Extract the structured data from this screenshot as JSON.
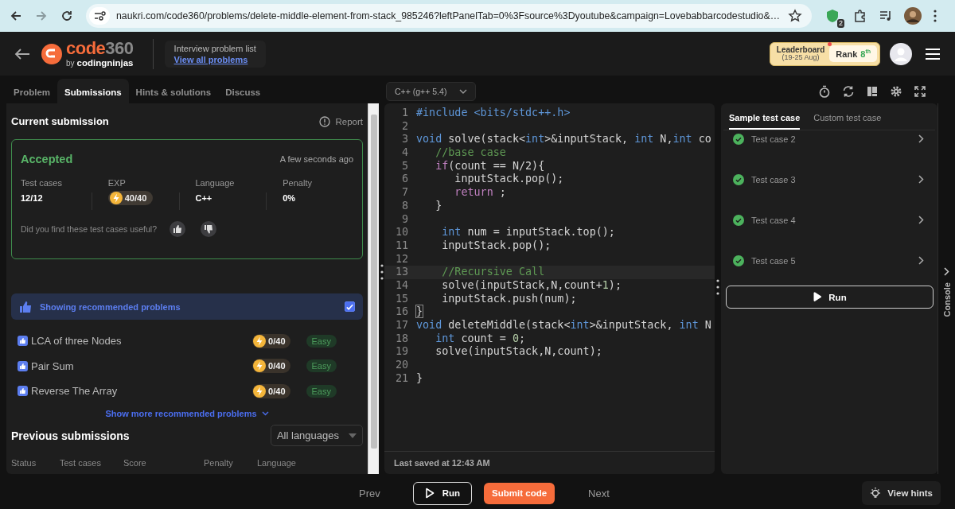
{
  "browser": {
    "url": "naukri.com/code360/problems/delete-middle-element-from-stack_985246?leftPanelTab=0%3Fsource%3Dyoutube&campaign=Lovebabbarcodestudio&…",
    "extension_badge": "2"
  },
  "header": {
    "logo_word": "code",
    "logo_number": "360",
    "logo_by": "by",
    "logo_brand": "codingninjas",
    "nav_caption": "Interview problem list",
    "nav_link": "View all problems",
    "leaderboard": {
      "title": "Leaderboard",
      "dates": "(19-25 Aug)",
      "rank_label": "Rank",
      "rank_value": "8$^{th}$",
      "notification": true
    }
  },
  "left_tabs": [
    {
      "label": "Problem",
      "selected": false
    },
    {
      "label": "Submissions",
      "selected": true
    },
    {
      "label": "Hints & solutions",
      "selected": false
    },
    {
      "label": "Discuss",
      "selected": false
    }
  ],
  "current_submission": {
    "title": "Current submission",
    "report": "Report",
    "status": "Accepted",
    "time": "A few seconds ago",
    "stats": [
      {
        "kind": "text",
        "label": "Test cases",
        "value": "12/12"
      },
      {
        "kind": "exp",
        "label": "EXP",
        "value": "40/40"
      },
      {
        "kind": "text",
        "label": "Language",
        "value": "C++"
      },
      {
        "kind": "text",
        "label": "Penalty",
        "value": "0%"
      }
    ],
    "feedback_question": "Did you find these test cases useful?"
  },
  "recommended": {
    "title": "Showing recommended problems",
    "checked": true,
    "problems": [
      {
        "title": "LCA of three Nodes",
        "exp": "0/40",
        "difficulty": "Easy"
      },
      {
        "title": "Pair Sum",
        "exp": "0/40",
        "difficulty": "Easy"
      },
      {
        "title": "Reverse The Array",
        "exp": "0/40",
        "difficulty": "Easy"
      }
    ],
    "show_more": "Show more recommended problems"
  },
  "previous_submissions": {
    "title": "Previous submissions",
    "filter": "All languages",
    "columns": [
      "Status",
      "Test cases",
      "Score",
      "Penalty",
      "Language"
    ]
  },
  "editor": {
    "language": "C++ (g++ 5.4)",
    "last_saved": "Last saved at 12:43 AM",
    "lines": [
      {
        "number": "1",
        "current": false,
        "tokens": [
          {
            "kind": "preproc",
            "text": "#include <bits/stdc++.h>"
          }
        ]
      },
      {
        "number": "2",
        "current": false
      },
      {
        "number": "3",
        "current": false,
        "tokens": [
          {
            "kind": "keyword",
            "text": "void"
          },
          {
            "kind": "plain",
            "text": " solve(stack<"
          },
          {
            "kind": "keyword",
            "text": "int"
          },
          {
            "kind": "plain",
            "text": ">&inputStack, "
          },
          {
            "kind": "keyword",
            "text": "int"
          },
          {
            "kind": "plain",
            "text": " N,"
          },
          {
            "kind": "keyword",
            "text": "int"
          },
          {
            "kind": "plain",
            "text": " co"
          }
        ]
      },
      {
        "number": "4",
        "current": false,
        "tokens": [
          {
            "kind": "comment",
            "text": "   //base case"
          }
        ]
      },
      {
        "number": "5",
        "current": false,
        "tokens": [
          {
            "kind": "control",
            "text": "   if"
          },
          {
            "kind": "plain",
            "text": "(count == N/2){"
          }
        ]
      },
      {
        "number": "6",
        "current": false,
        "tokens": [
          {
            "kind": "plain",
            "text": "      inputStack.pop();"
          }
        ]
      },
      {
        "number": "7",
        "current": false,
        "tokens": [
          {
            "kind": "control",
            "text": "      return"
          },
          {
            "kind": "plain",
            "text": " ;"
          }
        ]
      },
      {
        "number": "8",
        "current": false,
        "tokens": [
          {
            "kind": "plain",
            "text": "   }"
          }
        ]
      },
      {
        "number": "9",
        "current": false
      },
      {
        "number": "10",
        "current": false,
        "tokens": [
          {
            "kind": "keyword",
            "text": "    int"
          },
          {
            "kind": "plain",
            "text": " num = inputStack.top();"
          }
        ]
      },
      {
        "number": "11",
        "current": false,
        "tokens": [
          {
            "kind": "plain",
            "text": "    inputStack.pop();"
          }
        ]
      },
      {
        "number": "12",
        "current": false
      },
      {
        "number": "13",
        "current": true,
        "tokens": [
          {
            "kind": "comment",
            "text": "    //Recursive Call"
          }
        ]
      },
      {
        "number": "14",
        "current": false,
        "tokens": [
          {
            "kind": "plain",
            "text": "    solve(inputStack,N,count+"
          },
          {
            "kind": "number",
            "text": "1"
          },
          {
            "kind": "plain",
            "text": ");"
          }
        ]
      },
      {
        "number": "15",
        "current": false,
        "tokens": [
          {
            "kind": "plain",
            "text": "    inputStack.push(num);"
          }
        ]
      },
      {
        "number": "16",
        "current": false,
        "tokens": [
          {
            "kind": "matched",
            "text": "}"
          }
        ]
      },
      {
        "number": "17",
        "current": false,
        "tokens": [
          {
            "kind": "keyword",
            "text": "void"
          },
          {
            "kind": "plain",
            "text": " deleteMiddle(stack<"
          },
          {
            "kind": "keyword",
            "text": "int"
          },
          {
            "kind": "plain",
            "text": ">&inputStack, "
          },
          {
            "kind": "keyword",
            "text": "int"
          },
          {
            "kind": "plain",
            "text": " N"
          }
        ]
      },
      {
        "number": "18",
        "current": false,
        "tokens": [
          {
            "kind": "keyword",
            "text": "   int"
          },
          {
            "kind": "plain",
            "text": " count = "
          },
          {
            "kind": "number",
            "text": "0"
          },
          {
            "kind": "plain",
            "text": ";"
          }
        ]
      },
      {
        "number": "19",
        "current": false,
        "tokens": [
          {
            "kind": "plain",
            "text": "   solve(inputStack,N,count);"
          }
        ]
      },
      {
        "number": "20",
        "current": false
      },
      {
        "number": "21",
        "current": false,
        "tokens": [
          {
            "kind": "plain",
            "text": "}"
          }
        ]
      }
    ]
  },
  "test_panel": {
    "tabs": [
      {
        "label": "Sample test case",
        "selected": true
      },
      {
        "label": "Custom test case",
        "selected": false
      }
    ],
    "cases": [
      {
        "label": "Test case 2",
        "passed": true
      },
      {
        "label": "Test case 3",
        "passed": true
      },
      {
        "label": "Test case 4",
        "passed": true
      },
      {
        "label": "Test case 5",
        "passed": true
      }
    ],
    "run": "Run",
    "console": "Console"
  },
  "bottom_bar": {
    "prev": "Prev",
    "run": "Run",
    "submit": "Submit code",
    "next": "Next",
    "hints": "View hints"
  }
}
